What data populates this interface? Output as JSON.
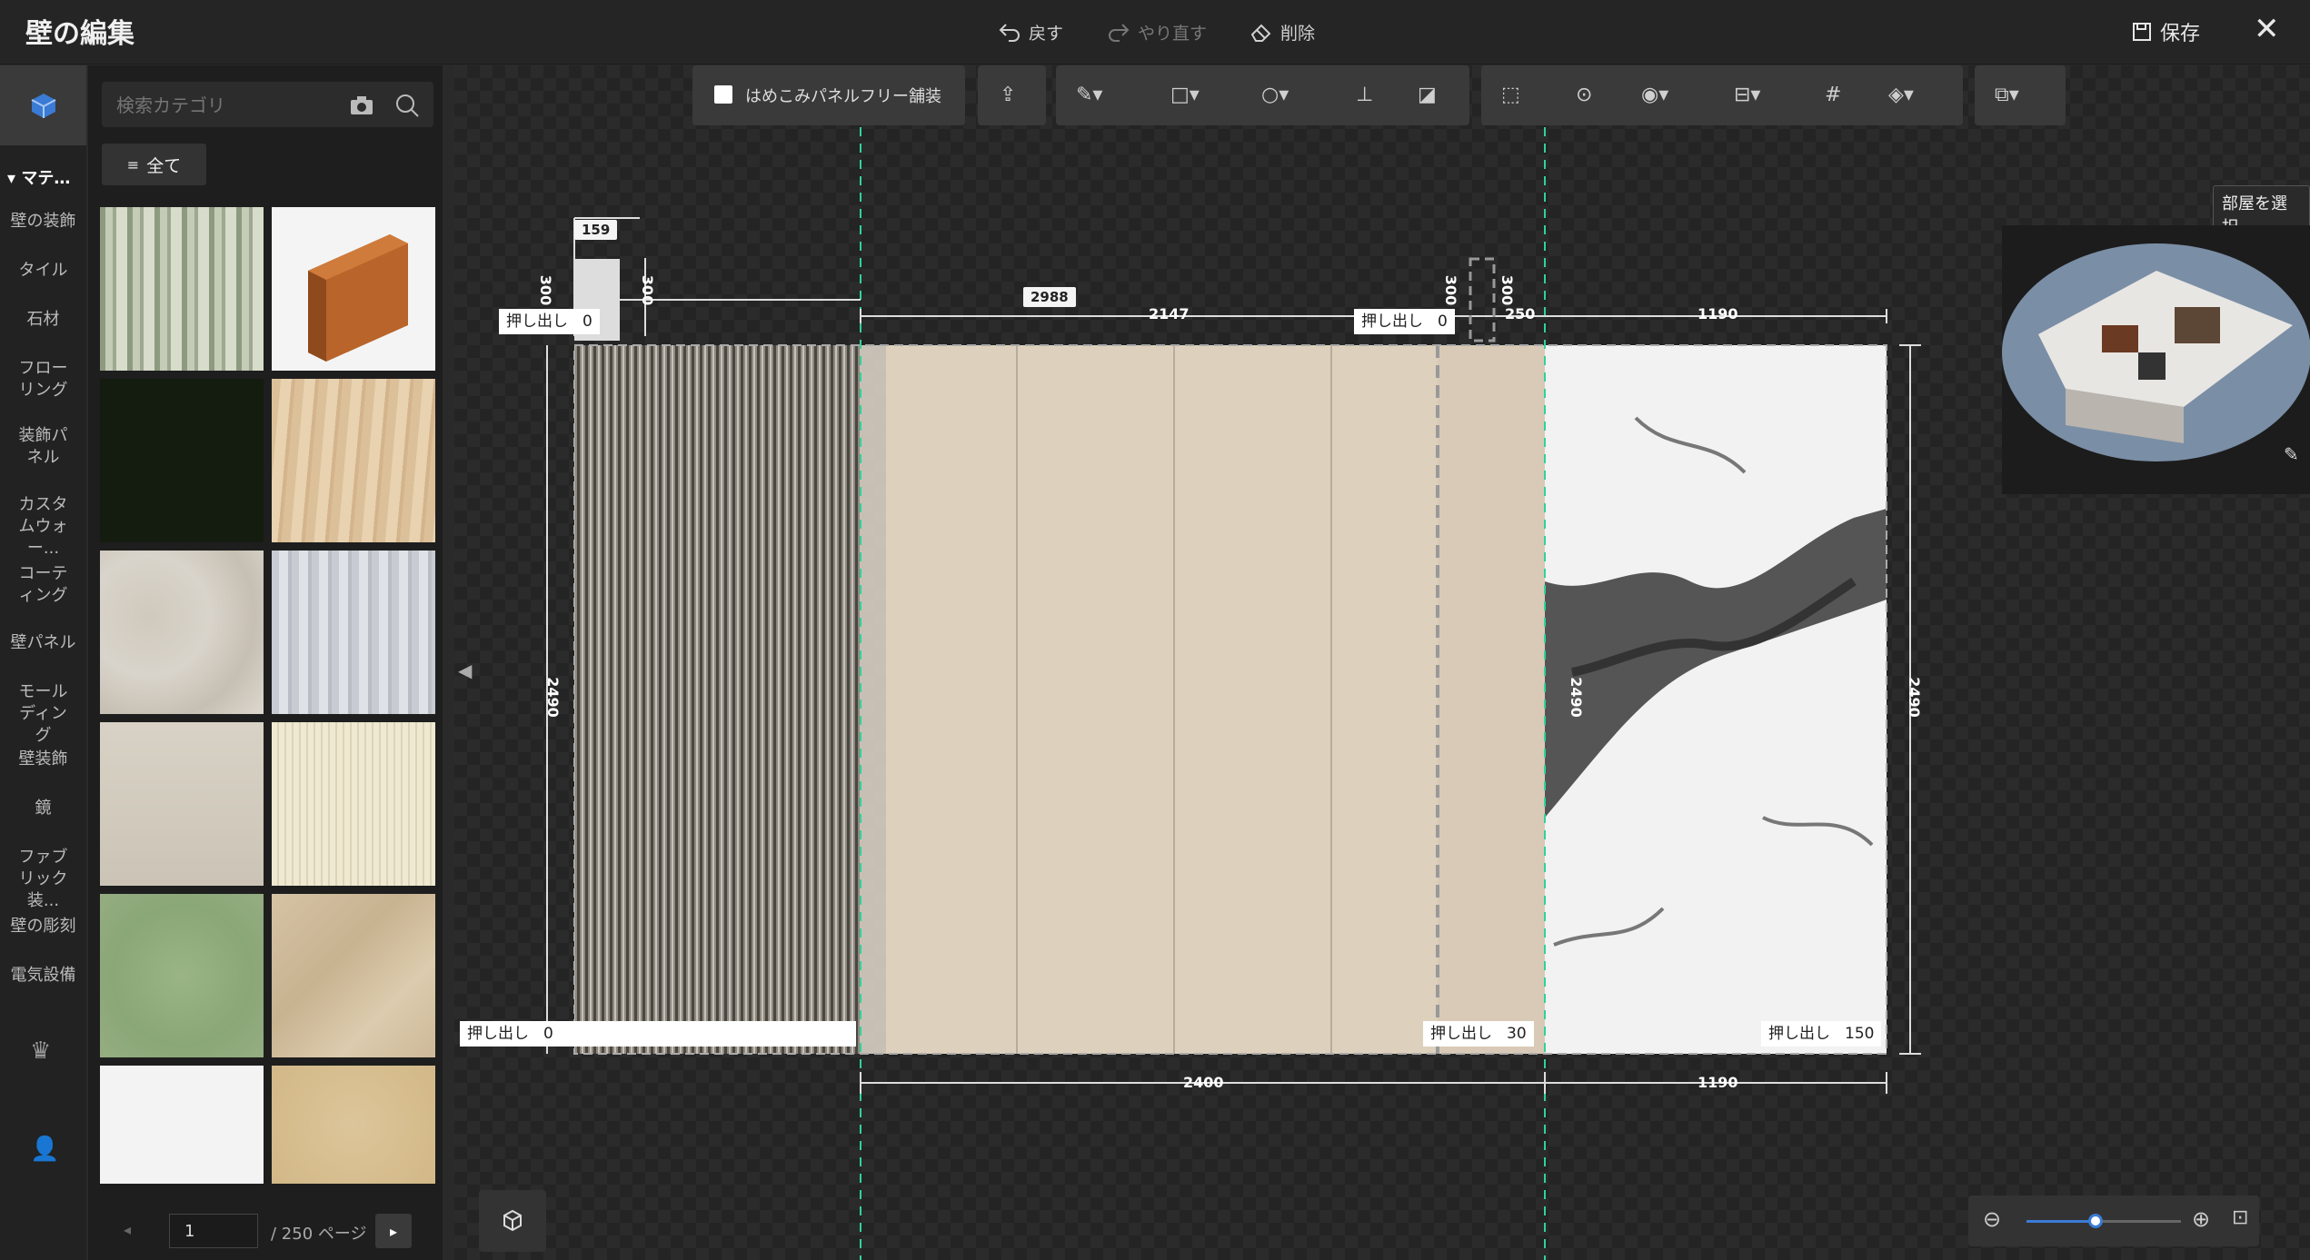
{
  "window": {
    "title": "壁の編集"
  },
  "topbar": {
    "undo_label": "戻す",
    "redo_label": "やり直す",
    "delete_label": "削除",
    "save_label": "保存"
  },
  "rail": {
    "section_label": "マテ…",
    "categories": [
      "壁の装飾",
      "タイル",
      "石材",
      "フローリング",
      "装飾パネル",
      "カスタムウォー...",
      "コーティング",
      "壁パネル",
      "モールディング",
      "壁装飾",
      "鏡",
      "ファブリック装...",
      "壁の彫刻",
      "電気設備"
    ]
  },
  "panel": {
    "search_placeholder": "検索カテゴリ",
    "all_label": "全て",
    "page_value": "1",
    "page_total": "/ 250 ページ"
  },
  "toolbar": {
    "panel_free_label": "はめこみパネルフリー舗装"
  },
  "canvas": {
    "room_select_label": "部屋を選択",
    "dims": {
      "d159": "159",
      "d300a": "300",
      "d300b": "300",
      "d300c": "300",
      "d300d": "300",
      "d2988": "2988",
      "d2147": "2147",
      "d250": "250",
      "d1190top": "1190",
      "d2400": "2400",
      "d1190bot": "1190",
      "d2490left": "2490",
      "d2490mid": "2490",
      "d2490right": "2490",
      "d240x": "2490"
    },
    "extrusions": [
      {
        "label": "押し出し",
        "value": "0"
      },
      {
        "label": "押し出し",
        "value": "0"
      },
      {
        "label": "押し出し",
        "value": "0"
      },
      {
        "label": "押し出し",
        "value": "30"
      },
      {
        "label": "押し出し",
        "value": "150"
      }
    ]
  },
  "colors": {
    "accent": "#3a7bd5",
    "beige": "#ddd0bd",
    "dashed_guide": "#2fd39a"
  }
}
